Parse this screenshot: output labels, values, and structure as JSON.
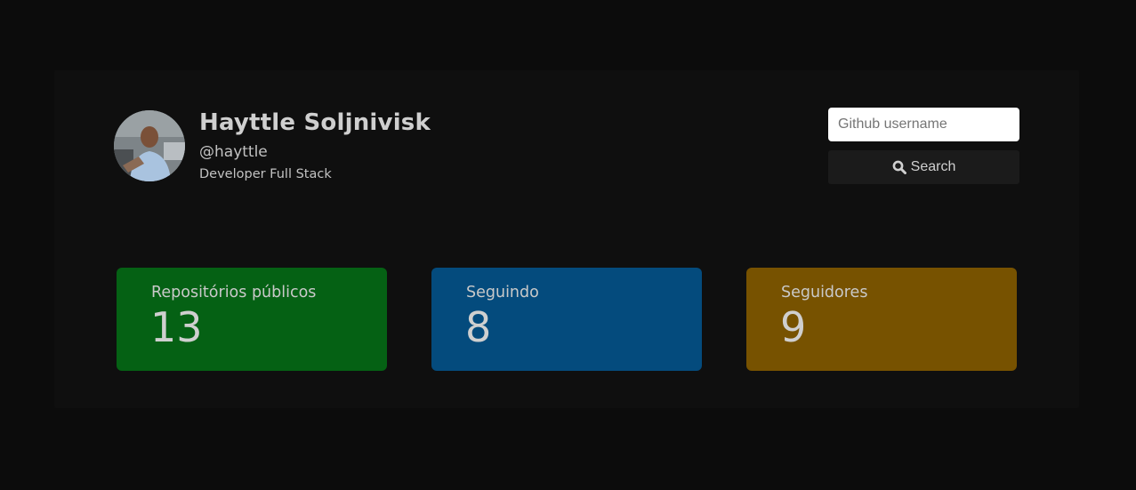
{
  "profile": {
    "name": "Hayttle Soljnivisk",
    "login": "@hayttle",
    "bio": "Developer Full Stack",
    "avatar_alt": "user-photo"
  },
  "search": {
    "placeholder": "Github username",
    "value": "",
    "button_label": "Search",
    "button_icon": "magnifier-icon"
  },
  "stats": [
    {
      "label": "Repositórios públicos",
      "value": "13",
      "color": "#056114"
    },
    {
      "label": "Seguindo",
      "value": "8",
      "color": "#044b7d"
    },
    {
      "label": "Seguidores",
      "value": "9",
      "color": "#775200"
    }
  ],
  "colors": {
    "page_background": "#0c0c0c",
    "card_background": "#0f0f0f",
    "text": "#c8c8c8",
    "button_background": "#1b1b1b"
  }
}
